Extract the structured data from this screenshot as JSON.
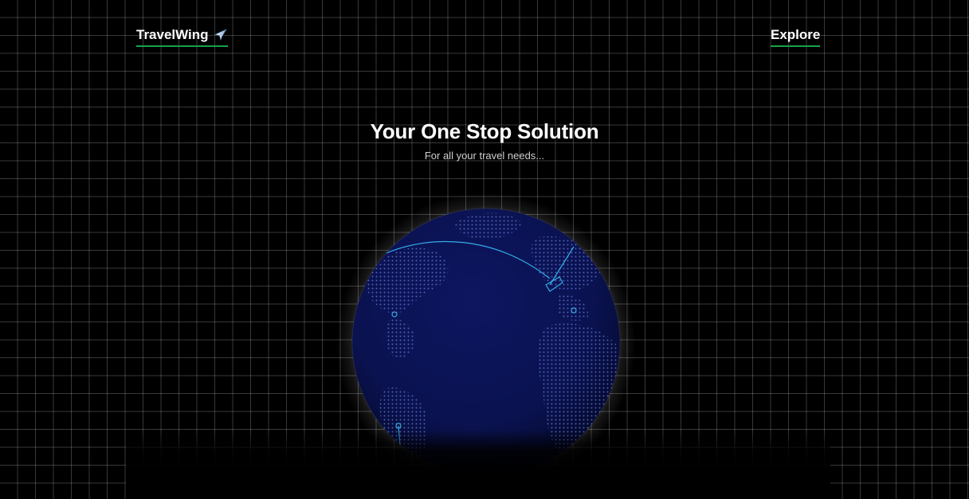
{
  "nav": {
    "brand_label": "TravelWing",
    "brand_icon": "airplane-icon",
    "explore_label": "Explore"
  },
  "hero": {
    "title": "Your One Stop Solution",
    "subtitle": "For all your travel needs..."
  },
  "globe": {
    "icon": "globe-icon",
    "ocean_color": "#0b1254",
    "land_color": "#4a5fbf",
    "arc_color": "#38bdf8"
  },
  "colors": {
    "background": "#000000",
    "grid_line": "#383838",
    "accent_underline": "#16a34a",
    "text": "#ffffff"
  }
}
